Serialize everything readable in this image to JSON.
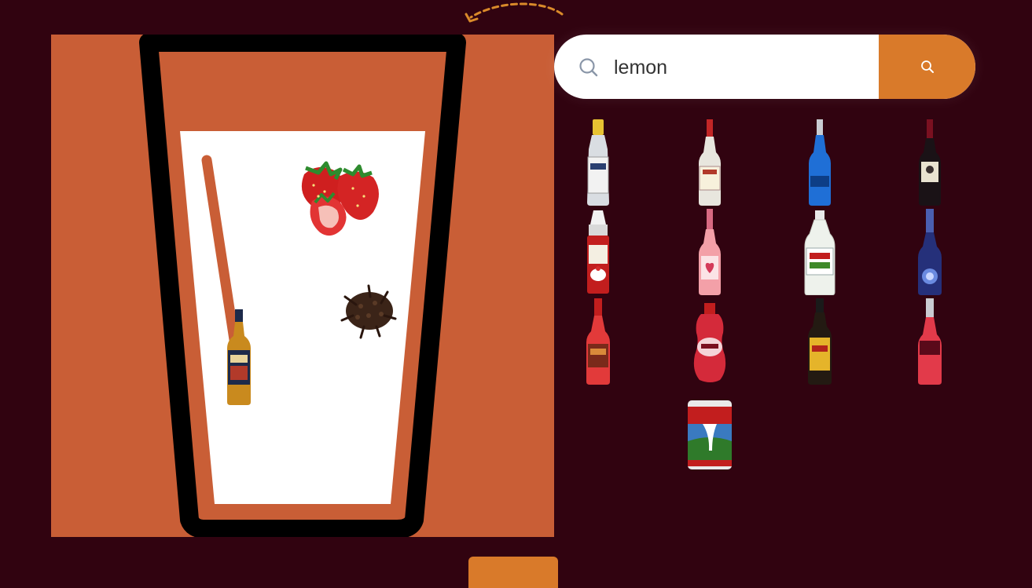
{
  "search": {
    "value": "lemon",
    "search_icon": "search-icon",
    "submit_icon": "search-icon"
  },
  "colors": {
    "background": "#310310",
    "canvas": "#c95e36",
    "accent": "#d97a2a",
    "glass_outline": "#000000",
    "liquid": "#ffffff"
  },
  "glass": {
    "ingredients": [
      "strawberries",
      "cloves",
      "whisky-bottle"
    ],
    "straw": true
  },
  "results": [
    "bitters-bottle",
    "clear-liqueur-bottle",
    "blue-curacao-bottle",
    "dark-liqueur-bottle",
    "whipped-cream-can",
    "rose-wine-bottle",
    "vinegar-bottle",
    "blue-liqueur-bottle",
    "red-syrup-bottle",
    "strawberry-syrup-bottle",
    "coffee-liqueur-bottle",
    "red-liqueur-bottle",
    "condensed-milk-can"
  ]
}
